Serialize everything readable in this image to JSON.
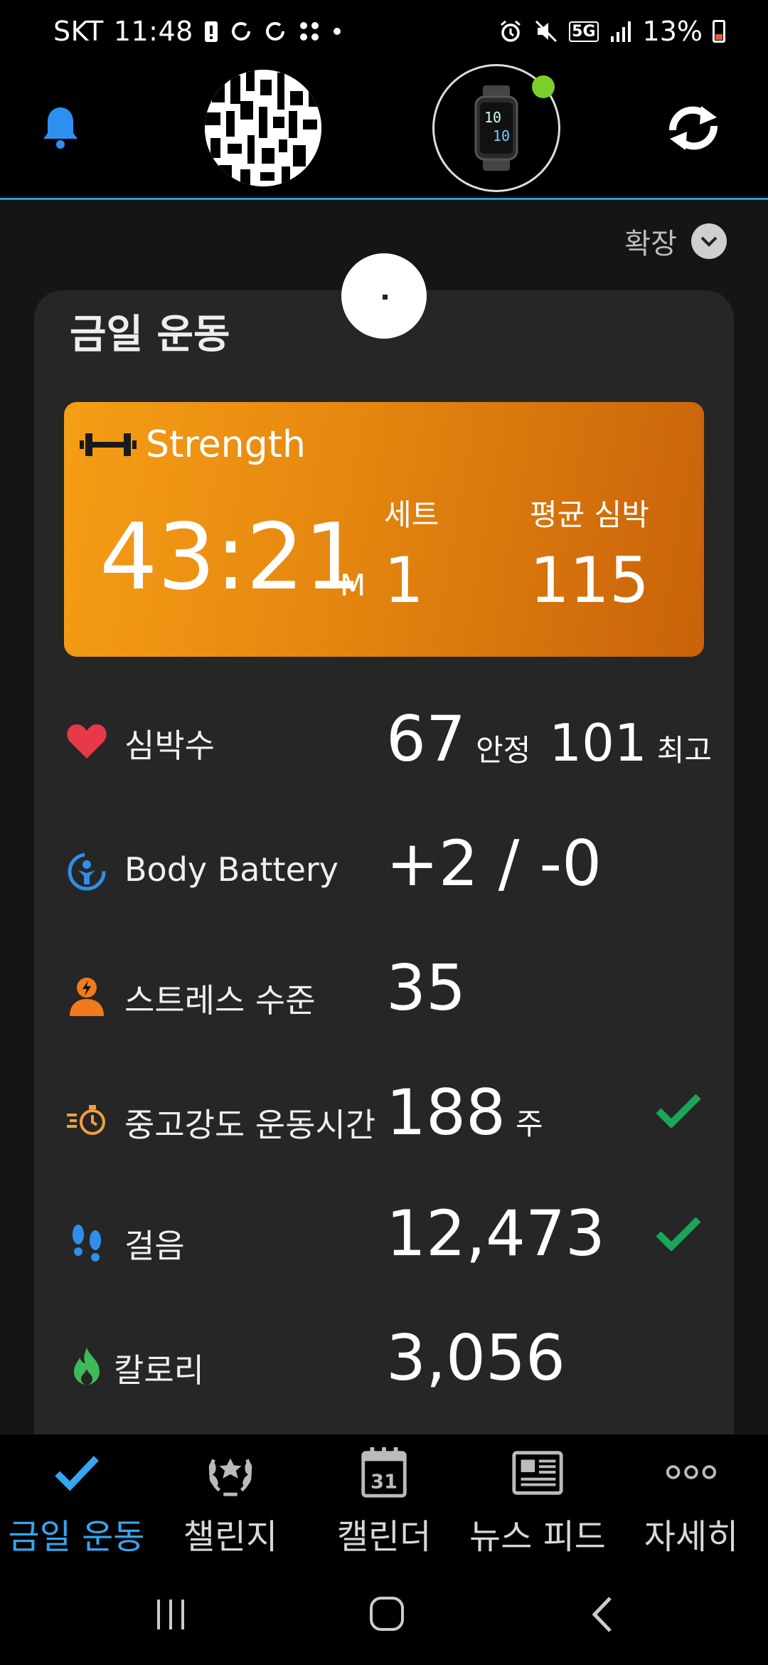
{
  "status_bar": {
    "carrier": "SKT",
    "time": "11:48",
    "network": "5G",
    "battery": "13%"
  },
  "header": {
    "expand_label": "확장"
  },
  "card": {
    "title": "금일 운동"
  },
  "activity": {
    "name": "Strength",
    "duration": "43:21",
    "duration_unit": "M",
    "sets_label": "세트",
    "sets_value": "1",
    "avg_hr_label": "평균 심박",
    "avg_hr_value": "115"
  },
  "metrics": {
    "heart_rate": {
      "label": "심박수",
      "resting_value": "67",
      "resting_label": "안정",
      "max_value": "101",
      "max_label": "최고"
    },
    "body_battery": {
      "label": "Body Battery",
      "value": "+2 / -0"
    },
    "stress": {
      "label": "스트레스 수준",
      "value": "35"
    },
    "intensity": {
      "label": "중고강도 운동시간",
      "value": "188",
      "unit": "주"
    },
    "steps": {
      "label": "걸음",
      "value": "12,473"
    },
    "calories": {
      "label": "칼로리",
      "value": "3,056"
    }
  },
  "bottom_nav": [
    {
      "label": "금일 운동",
      "icon": "check-icon",
      "active": true
    },
    {
      "label": "챌린지",
      "icon": "laurel-icon",
      "active": false
    },
    {
      "label": "캘린더",
      "icon": "calendar-icon",
      "calendar_day": "31",
      "active": false
    },
    {
      "label": "뉴스 피드",
      "icon": "newspaper-icon",
      "active": false
    },
    {
      "label": "자세히",
      "icon": "more-icon",
      "active": false
    }
  ],
  "colors": {
    "accent": "#35a6f0",
    "activity_gradient_start": "#f59e16",
    "activity_gradient_end": "#c9620a",
    "heart": "#e8394a",
    "stress": "#f07a1c",
    "intensity": "#f0a040",
    "steps": "#2f8fe8",
    "calories": "#3dbb5a",
    "check": "#19a65a"
  }
}
